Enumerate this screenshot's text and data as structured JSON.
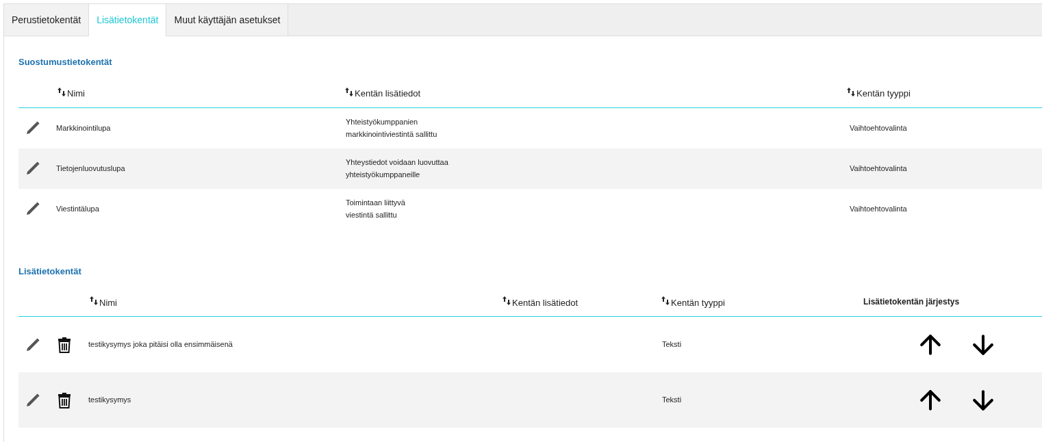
{
  "tabs": [
    {
      "label": "Perustietokentät",
      "selected": false
    },
    {
      "label": "Lisätietokentät",
      "selected": true
    },
    {
      "label": "Muut käyttäjän asetukset",
      "selected": false
    }
  ],
  "consent_section": {
    "title": "Suostumustietokentät",
    "columns": [
      "Nimi",
      "Kentän lisätiedot",
      "Kentän tyyppi"
    ],
    "rows": [
      {
        "name": "Markkinointilupa",
        "details": "Yhteistyökumppanien\nmarkkinointiviestintä sallittu",
        "type": "Vaihtoehtovalinta"
      },
      {
        "name": "Tietojenluovutuslupa",
        "details": "Yhteystiedot voidaan luovuttaa\nyhteistyökumppaneille",
        "type": "Vaihtoehtovalinta"
      },
      {
        "name": "Viestintälupa",
        "details": "Toimintaan liittyvä\nviestintä sallittu",
        "type": "Vaihtoehtovalinta"
      }
    ]
  },
  "extra_section": {
    "title": "Lisätietokentät",
    "columns": [
      "Nimi",
      "Kentän lisätiedot",
      "Kentän tyyppi"
    ],
    "order_column": "Lisätietokentän järjestys",
    "rows": [
      {
        "name": "testikysymys joka pitäisi olla ensimmäisenä",
        "type": "Teksti"
      },
      {
        "name": "testikysymys",
        "type": "Teksti"
      }
    ]
  }
}
